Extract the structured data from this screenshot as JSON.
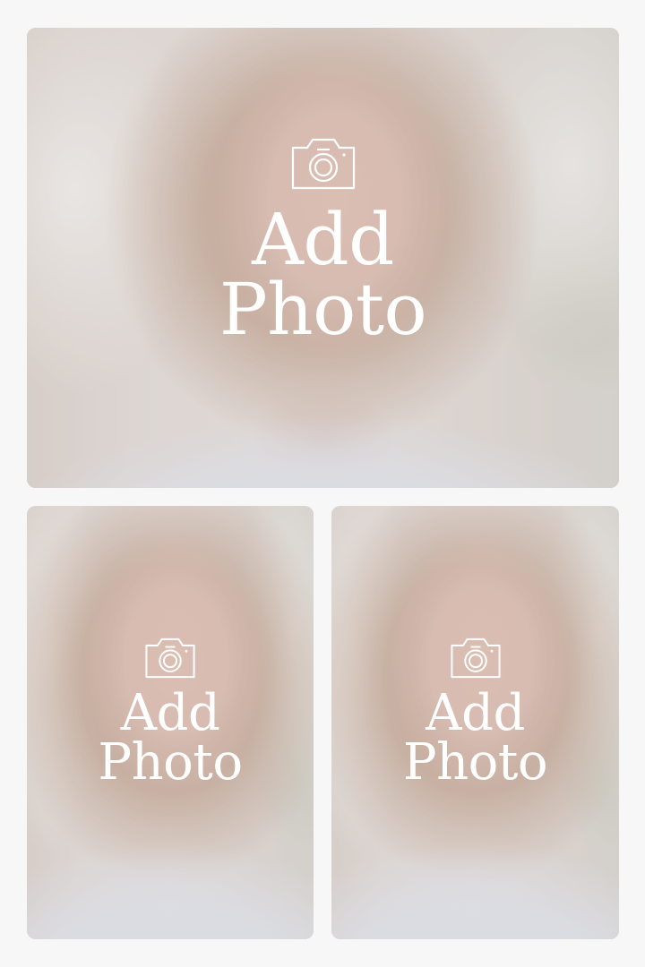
{
  "slots": [
    {
      "id": "top",
      "line1": "Add",
      "line2": "Photo",
      "icon": "camera-icon"
    },
    {
      "id": "bottom-left",
      "line1": "Add",
      "line2": "Photo",
      "icon": "camera-icon"
    },
    {
      "id": "bottom-right",
      "line1": "Add",
      "line2": "Photo",
      "icon": "camera-icon"
    }
  ],
  "colors": {
    "background": "#f7f7f7",
    "overlay_text": "#ffffff"
  }
}
